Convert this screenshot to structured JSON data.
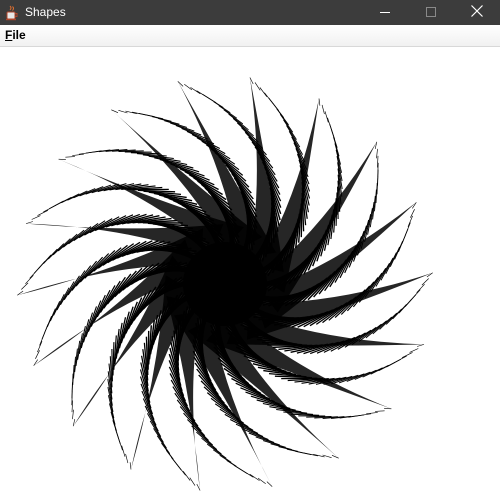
{
  "window": {
    "title": "Shapes",
    "icon": "java-cup-icon",
    "controls": [
      "minimize-icon",
      "maximize-icon",
      "close-icon"
    ],
    "titlebar_color": "#3c3c3c"
  },
  "menubar": {
    "items": [
      {
        "label": "File",
        "mnemonic": "F",
        "rest": "ile"
      }
    ]
  },
  "canvas": {
    "background": "#ffffff",
    "stroke_color": "#000000",
    "shape": "spiral-star"
  }
}
